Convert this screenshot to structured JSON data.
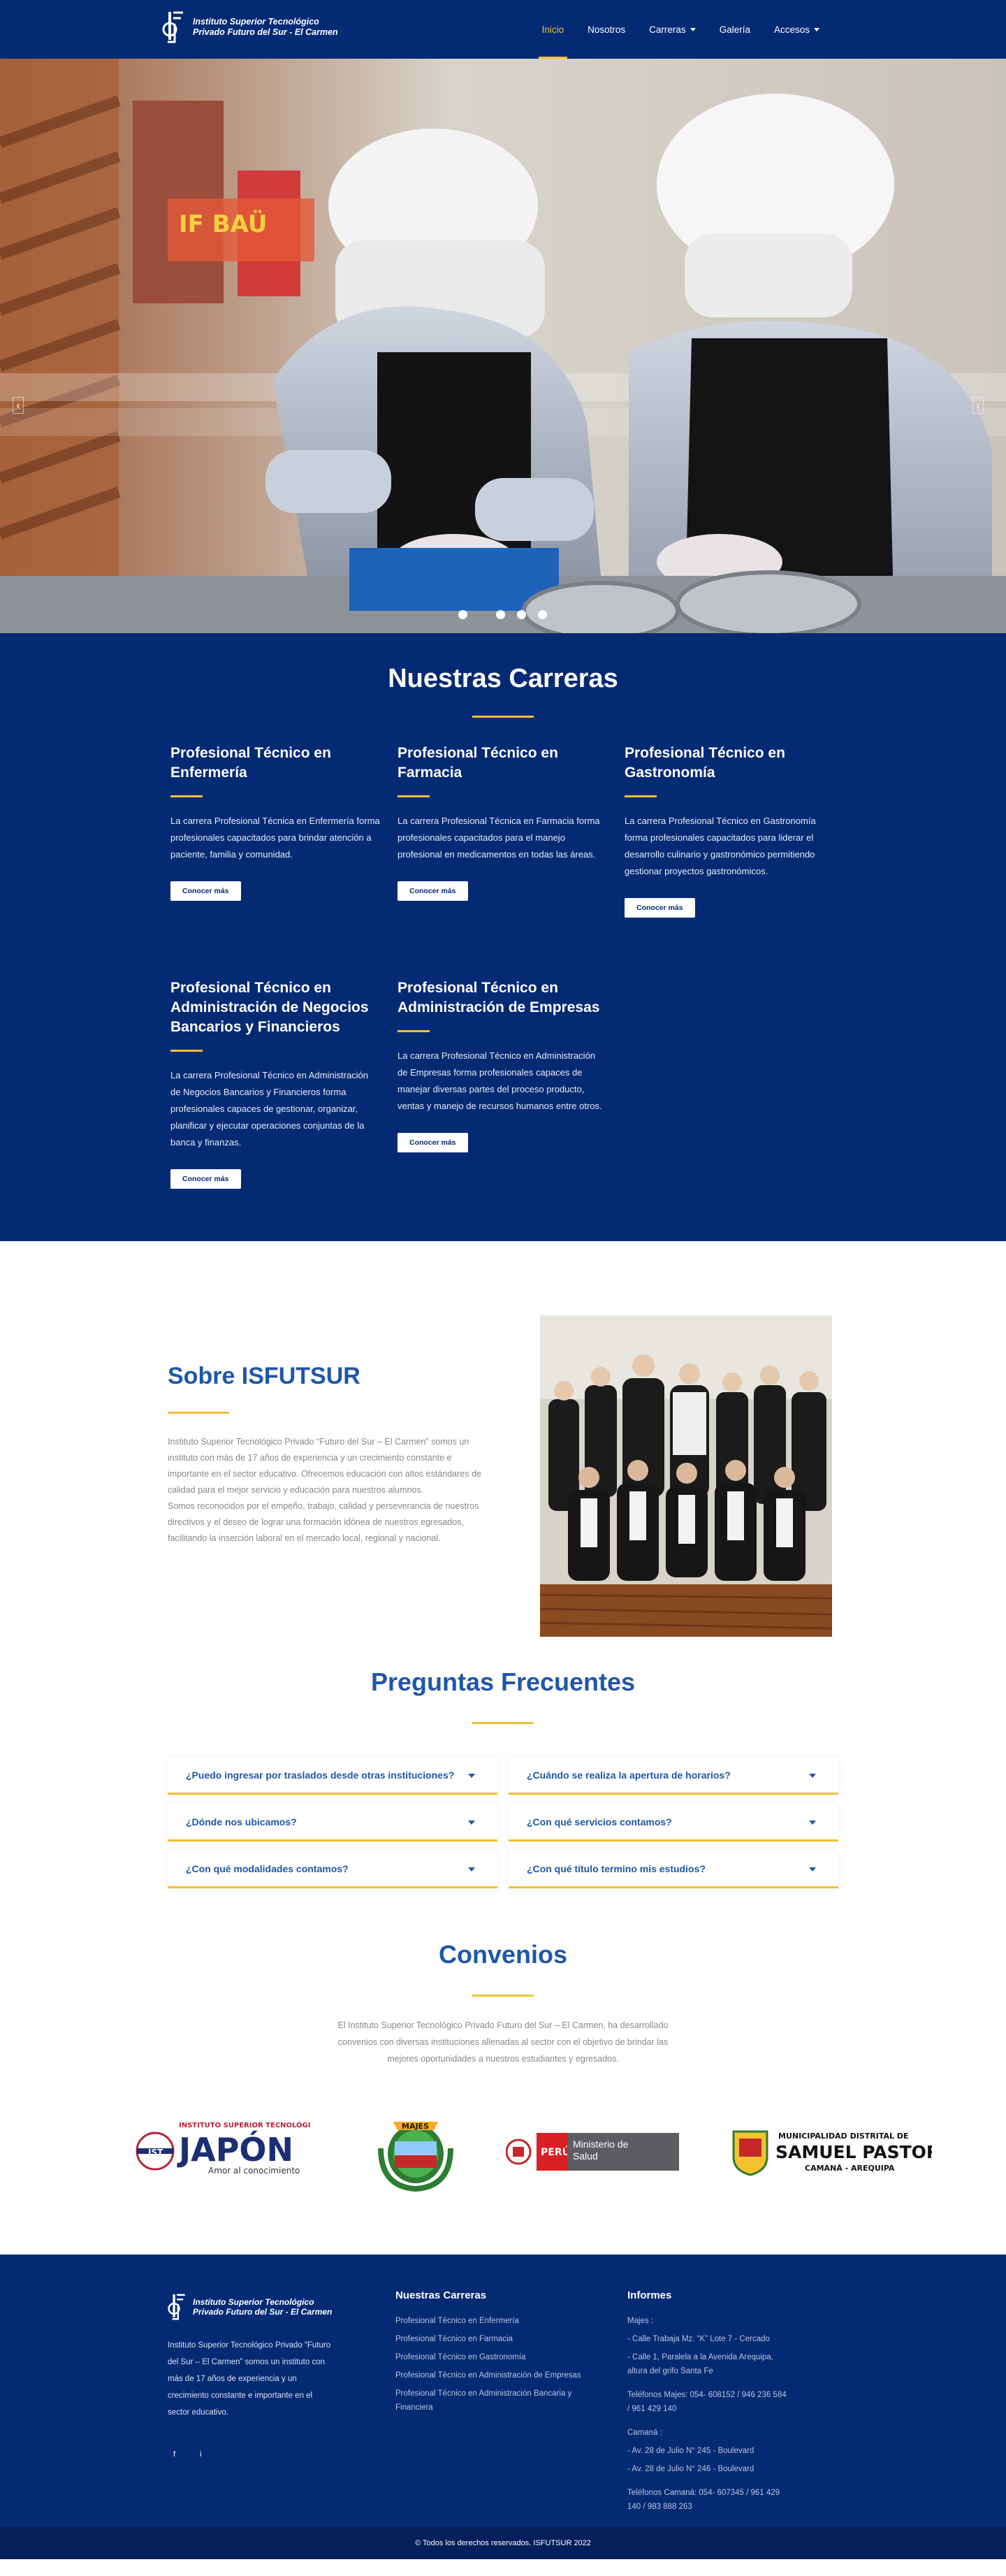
{
  "header": {
    "logo_line1": "Instituto Superior Tecnológico",
    "logo_line2": "Privado Futuro del Sur - El Carmen",
    "nav": [
      {
        "label": "Inicio",
        "active": true,
        "dropdown": false
      },
      {
        "label": "Nosotros",
        "active": false,
        "dropdown": false
      },
      {
        "label": "Carreras",
        "active": false,
        "dropdown": true
      },
      {
        "label": "Galería",
        "active": false,
        "dropdown": false
      },
      {
        "label": "Accesos",
        "active": false,
        "dropdown": true
      }
    ]
  },
  "hero": {
    "slides_count": 4,
    "active_slide": 1,
    "banner_text": "IF BAÜ"
  },
  "carreras": {
    "title": "Nuestras Carreras",
    "items": [
      {
        "title": "Profesional Técnico en Enfermería",
        "desc": "La carrera Profesional Técnica en Enfermería forma profesionales capacitados para brindar atención a paciente, familia y comunidad.",
        "button": "Conocer más"
      },
      {
        "title": "Profesional Técnico en Farmacia",
        "desc": "La carrera Profesional Técnica en Farmacia forma profesionales capacitados para el manejo profesional en medicamentos en todas las áreas.",
        "button": "Conocer más"
      },
      {
        "title": "Profesional Técnico en Gastronomía",
        "desc": "La carrera Profesional Técnico en Gastronomía forma profesionales capacitados para liderar el desarrollo culinario y gastronómico permitiendo gestionar proyectos gastronómicos.",
        "button": "Conocer más"
      },
      {
        "title": "Profesional Técnico en Administración de Negocios Bancarios y Financieros",
        "desc": "La carrera Profesional Técnico en Administración de Negocios Bancarios y Financieros forma profesionales capaces de gestionar, organizar, planificar y ejecutar operaciones conjuntas de la banca y finanzas.",
        "button": "Conocer más"
      },
      {
        "title": "Profesional Técnico en Administración de Empresas",
        "desc": "La carrera Profesional Técnico en Administración de Empresas forma profesionales capaces de manejar diversas partes del proceso producto, ventas y manejo de recursos humanos entre otros.",
        "button": "Conocer más"
      }
    ]
  },
  "sobre": {
    "title": "Sobre ISFUTSUR",
    "text": "Instituto Superior Tecnológico Privado “Futuro del Sur – El Carmen” somos un instituto con más de 17 años de experiencia y un crecimiento constante e importante en el sector educativo. Ofrecemos educación con altos estándares de calidad para el mejor servicio y educación para nuestros alumnos.\nSomos reconocidos por el empeño, trabajo, calidad y perseverancia de nuestros directivos y el deseo de lograr una formación idónea de nuestros egresados, facilitando la inserción laboral en el mercado local, regional y nacional."
  },
  "faq": {
    "title": "Preguntas Frecuentes",
    "items": [
      "¿Puedo ingresar por traslados desde otras instituciones?",
      "¿Cuándo se realiza la apertura de horarios?",
      "¿Dónde nos ubicamos?",
      "¿Con qué servicios contamos?",
      "¿Con qué modalidades contamos?",
      "¿Con qué título termino mis estudios?"
    ]
  },
  "convenios": {
    "title": "Convenios",
    "text": "El Instituto Superior Tecnológico Privado Futuro del Sur – El Carmen, ha desarrollado convenios con diversas instituciones allenadas al sector con el objetivo de brindar las mejores oportunidades a nuestros estudiantes y egresados.",
    "logos": {
      "japon_top": "INSTITUTO SUPERIOR TECNOLÓGICO",
      "japon_main": "JAPÓN",
      "japon_sub": "Amor al conocimiento",
      "japon_badge": "IST",
      "majes": "MAJES",
      "minsa_peru": "PERÚ",
      "minsa_name": "Ministerio de Salud",
      "muni_top": "MUNICIPALIDAD DISTRITAL DE",
      "muni_main": "SAMUEL PASTOR",
      "muni_sub": "CAMANÁ - AREQUIPA"
    }
  },
  "footer": {
    "about": "Instituto Superior Tecnológico Privado “Futuro del Sur – El Carmen” somos un instituto con más de 17 años de experiencia y un crecimiento constante e importante en el sector educativo.",
    "carreras_title": "Nuestras Carreras",
    "carreras_links": [
      "Profesional Técnico en Enfermería",
      "Profesional Técnico en Farmacia",
      "Profesional Técnico en Gastronomía",
      "Profesional Técnico en Administración de Empresas",
      "Profesional Técnico en Administración Bancaria y Financiera"
    ],
    "informes_title": "Informes",
    "informes_lines": [
      "Majes :",
      "- Calle Trabaja Mz. “K” Lote 7 - Cercado",
      "- Calle 1, Paralela a la Avenida Arequipa, altura del grifo Santa Fe",
      "Teléfonos Majes: 054- 608152 / 946 236 584 / 961 429 140",
      "Camaná :",
      "- Av. 28 de Julio N° 245 - Boulevard",
      "- Av. 28 de Julio N° 246 - Boulevard",
      "Teléfonos Camaná: 054- 607345 / 961 429 140 / 983 888 263"
    ],
    "copyright": "© Todos los derechos reservados. ISFUTSUR 2022",
    "social": [
      "f",
      "i"
    ]
  },
  "colors": {
    "primary": "#052a74",
    "accent": "#f1c232",
    "heading": "#1f57a8"
  }
}
